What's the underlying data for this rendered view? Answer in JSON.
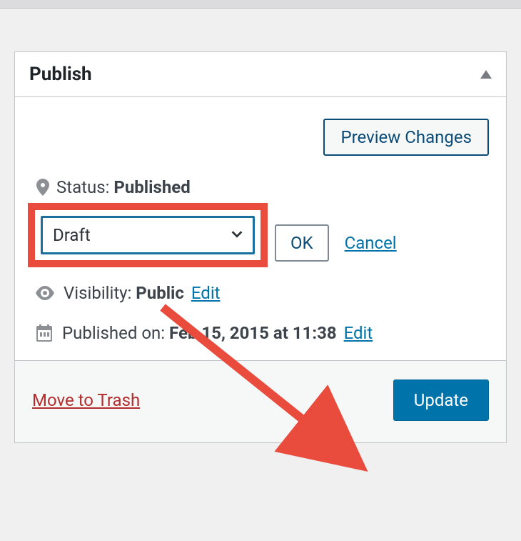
{
  "panel": {
    "title": "Publish",
    "preview_label": "Preview Changes",
    "status": {
      "label": "Status:",
      "value": "Published",
      "select_value": "Draft",
      "ok_label": "OK",
      "cancel_label": "Cancel"
    },
    "visibility": {
      "label": "Visibility:",
      "value": "Public",
      "edit_label": "Edit"
    },
    "published": {
      "label": "Published on:",
      "date": "Feb 15, 2015 at 11:38",
      "edit_label": "Edit"
    },
    "trash_label": "Move to Trash",
    "update_label": "Update"
  }
}
